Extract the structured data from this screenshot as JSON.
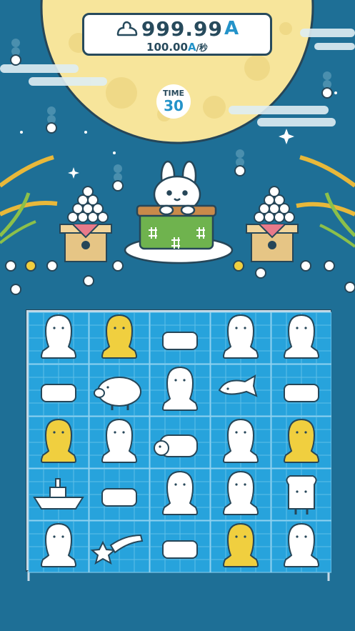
{
  "hud": {
    "score_value": "999.99",
    "score_unit": "A",
    "rate_value": "100.00",
    "rate_unit": "A",
    "rate_per": "/秒",
    "time_label": "TIME",
    "time_value": "30"
  },
  "colors": {
    "sky": "#1e6f96",
    "moon": "#f7e59b",
    "board_tile": "#27a3dc",
    "board_frame": "#c7dbe8",
    "accent_text": "#2493c9",
    "dark_text": "#274a5c",
    "gold_mochi": "#f0cf3f",
    "kotatsu_green": "#6fb34e"
  },
  "board": {
    "rows": 5,
    "cols": 5,
    "cells": [
      [
        "ghost",
        "gold-ghost",
        "mochi",
        "ghost",
        "ghost"
      ],
      [
        "mochi",
        "pig",
        "ghost",
        "taiyaki",
        "mochi"
      ],
      [
        "gold-ghost",
        "ghost",
        "dog",
        "ghost",
        "gold-ghost"
      ],
      [
        "boat",
        "mochi",
        "ghost",
        "ghost",
        "toast-man"
      ],
      [
        "ghost",
        "shooting-star",
        "mochi",
        "gold-ghost",
        "ghost"
      ]
    ]
  }
}
